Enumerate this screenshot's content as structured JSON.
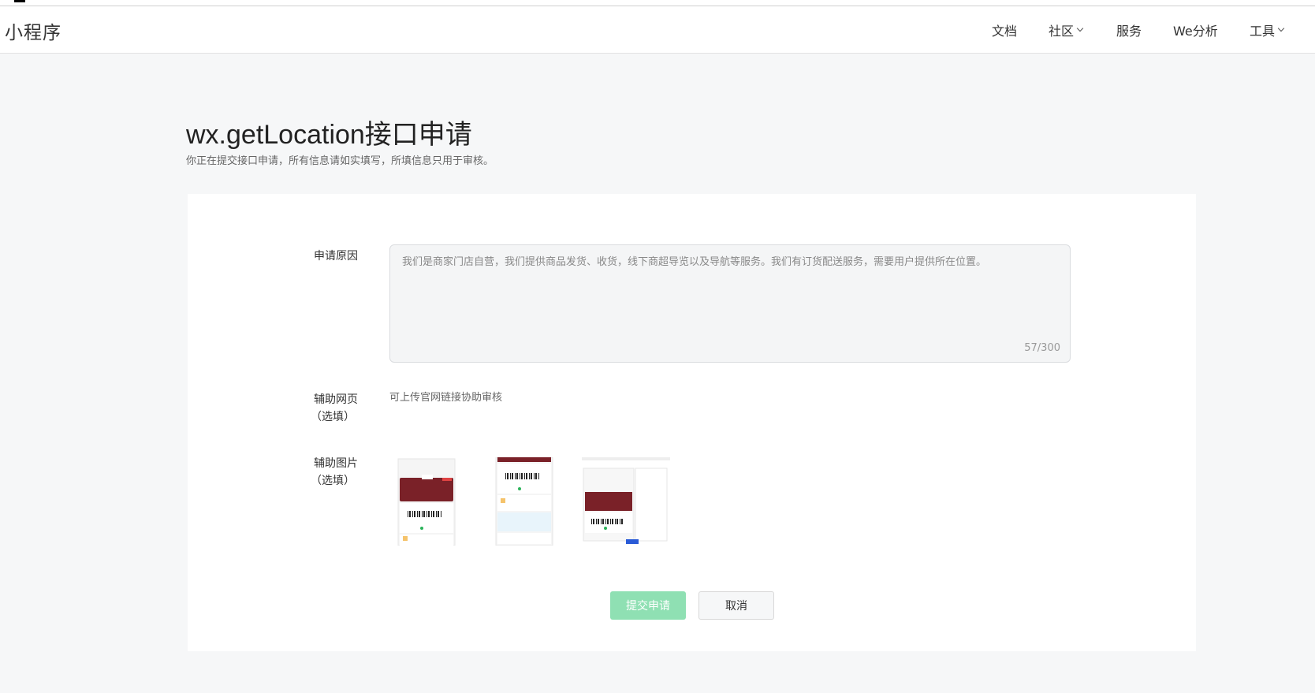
{
  "header": {
    "brand": "小程序",
    "nav": {
      "docs": "文档",
      "community": "社区",
      "services": "服务",
      "analytics": "We分析",
      "tools": "工具"
    }
  },
  "page": {
    "title": "wx.getLocation接口申请",
    "subtitle": "你正在提交接口申请，所有信息请如实填写，所填信息只用于审核。"
  },
  "form": {
    "reason_label": "申请原因",
    "reason_value": "我们是商家门店自营，我们提供商品发货、收货，线下商超导览以及导航等服务。我们有订货配送服务，需要用户提供所在位置。",
    "reason_counter": "57/300",
    "webpage_label": "辅助网页",
    "webpage_optional": "（选填）",
    "webpage_hint": "可上传官网链接协助审核",
    "images_label": "辅助图片",
    "images_optional": "（选填）",
    "submit_label": "提交申请",
    "cancel_label": "取消"
  },
  "colors": {
    "accent_disabled": "#8fe0b3",
    "card_red": "#7a2128"
  },
  "thumbnails": [
    {
      "name": "screenshot-1"
    },
    {
      "name": "screenshot-2"
    },
    {
      "name": "screenshot-3"
    }
  ]
}
